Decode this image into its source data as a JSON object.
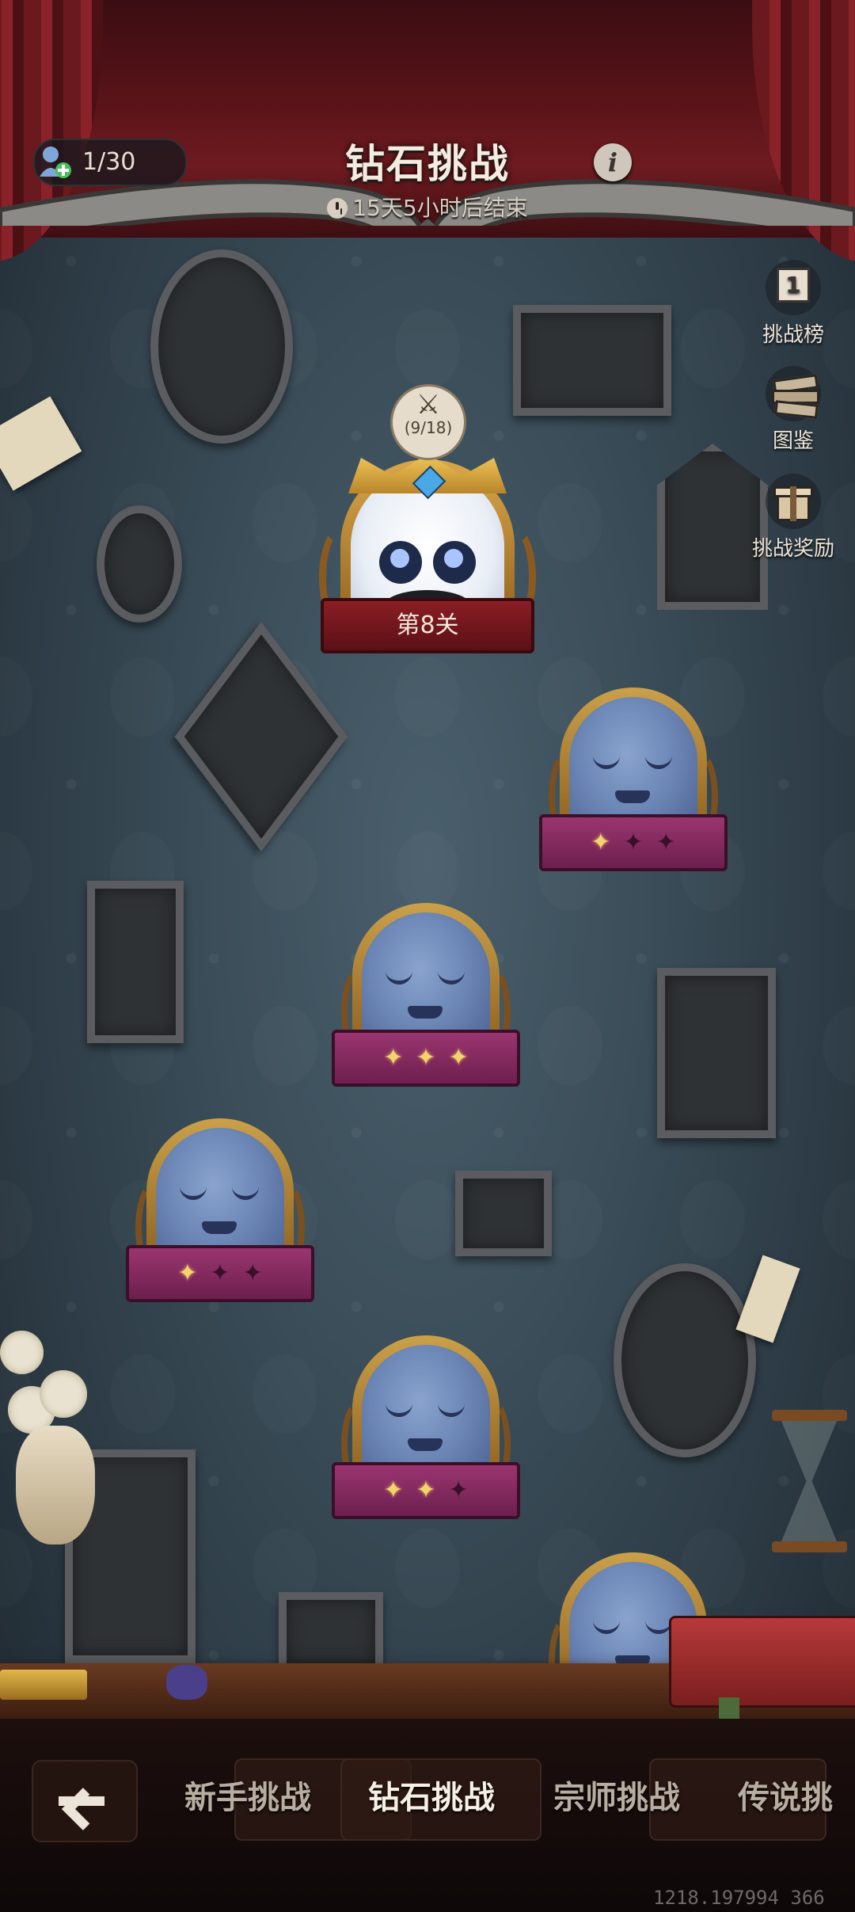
{
  "header": {
    "title": "钻石挑战",
    "countdown": "15天5小时后结束",
    "players": "1/30",
    "info_icon": "i"
  },
  "side_menu": [
    {
      "label": "挑战榜",
      "icon": "leaderboard-icon",
      "badge": "1"
    },
    {
      "label": "图鉴",
      "icon": "book-stack-icon"
    },
    {
      "label": "挑战奖励",
      "icon": "gift-box-icon"
    }
  ],
  "current_level": {
    "label": "第8关",
    "progress": "(9/18)"
  },
  "levels": [
    {
      "stars": 1
    },
    {
      "stars": 3
    },
    {
      "stars": 1
    },
    {
      "stars": 2
    }
  ],
  "bottom_tabs": [
    "新手挑战",
    "钻石挑战",
    "宗师挑战",
    "传说挑战"
  ],
  "active_tab": "钻石挑战",
  "coordinate_readout": "1218.197994 366",
  "colors": {
    "ribbon": "#8a2a5e",
    "star_on": "#f3d46a",
    "wall": "#3b4e5a"
  }
}
